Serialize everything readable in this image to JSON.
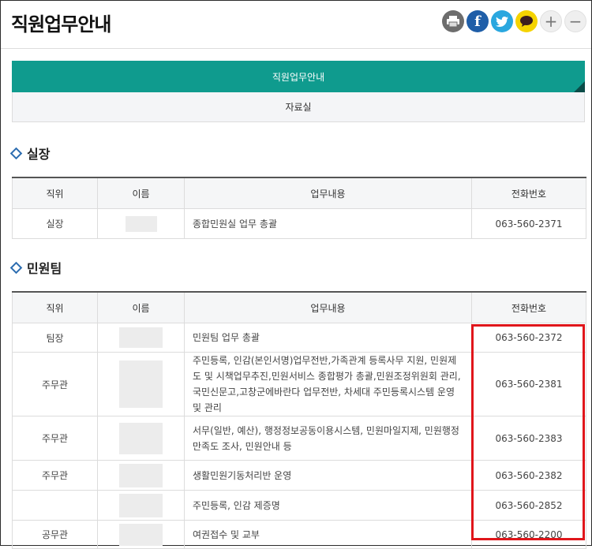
{
  "page": {
    "title": "직원업무안내"
  },
  "share": {
    "plus_label": "+",
    "minus_label": "−",
    "fb_label": "f"
  },
  "tabs": [
    {
      "label": "직원업무안내"
    },
    {
      "label": "자료실"
    }
  ],
  "sections": [
    {
      "title": "실장",
      "headers": [
        "직위",
        "이름",
        "업무내용",
        "전화번호"
      ],
      "rows": [
        {
          "position": "실장",
          "duty": "종합민원실 업무 총괄",
          "phone": "063-560-2371"
        }
      ]
    },
    {
      "title": "민원팀",
      "headers": [
        "직위",
        "이름",
        "업무내용",
        "전화번호"
      ],
      "rows": [
        {
          "position": "팀장",
          "duty": "민원팀 업무 총괄",
          "phone": "063-560-2372"
        },
        {
          "position": "주무관",
          "duty": "주민등록, 인감(본인서명)업무전반,가족관계 등록사무 지원, 민원제도 및 시책업무추진,민원서비스 종합평가 총괄,민원조정위원회 관리,국민신문고,고창군에바란다 업무전반, 차세대 주민등록시스템 운영 및 관리",
          "phone": "063-560-2381"
        },
        {
          "position": "주무관",
          "duty": "서무(일반, 예산), 행정정보공동이용시스템, 민원마일지제, 민원행정만족도 조사, 민원안내 등",
          "phone": "063-560-2383"
        },
        {
          "position": "주무관",
          "duty": "생활민원기동처리반 운영",
          "phone": "063-560-2382"
        },
        {
          "position": "",
          "duty": "주민등록, 인감 제증명",
          "phone": "063-560-2852"
        },
        {
          "position": "공무관",
          "duty": "여권접수 및 교부",
          "phone": "063-560-2200"
        }
      ]
    }
  ]
}
